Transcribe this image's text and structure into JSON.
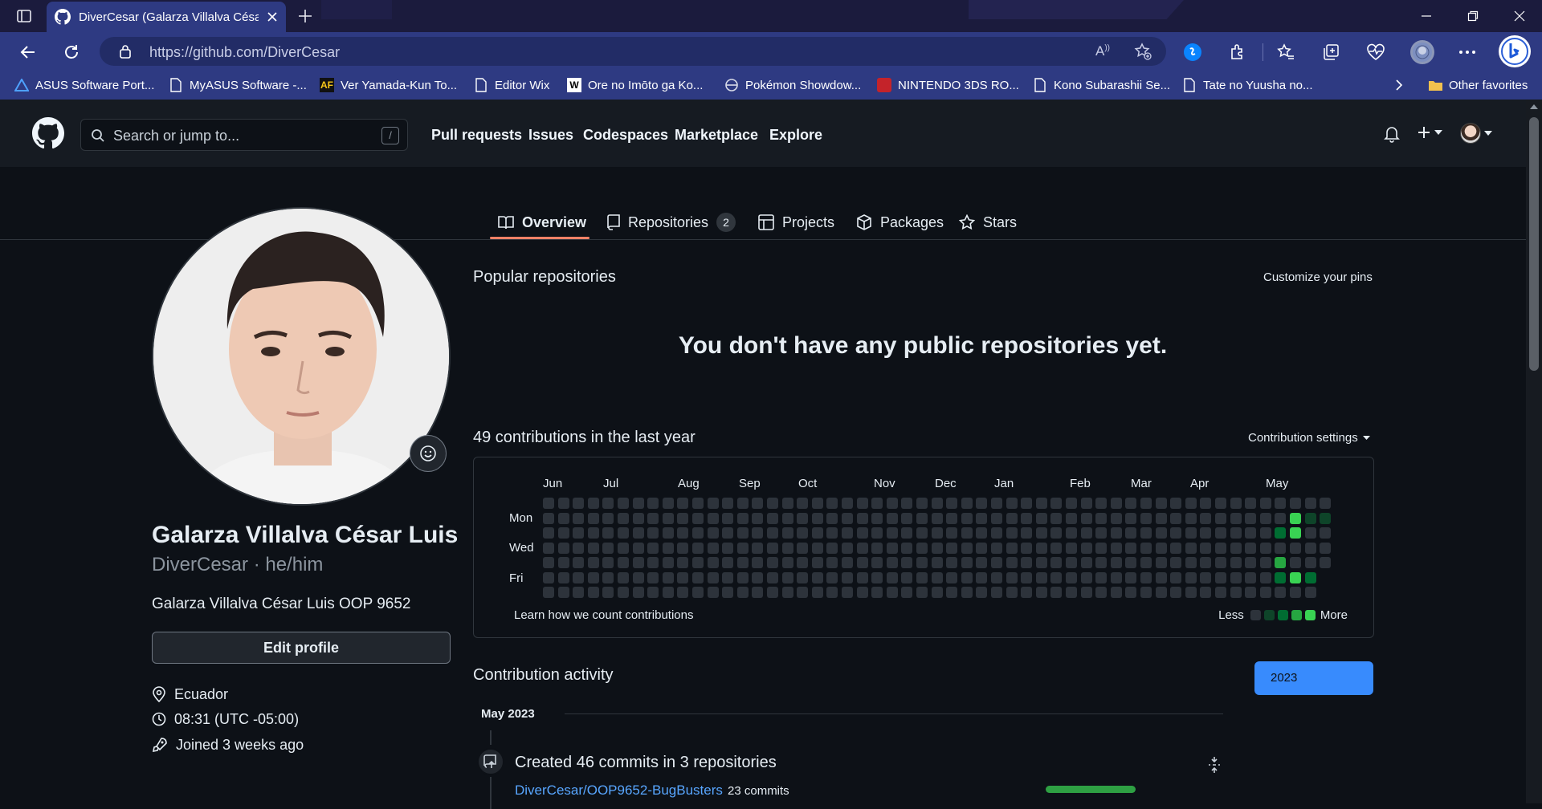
{
  "browser": {
    "tab_title": "DiverCesar (Galarza Villalva Césa",
    "url": "https://github.com/DiverCesar",
    "favorites": [
      {
        "label": "ASUS Software Port...",
        "icon": "asus-icon"
      },
      {
        "label": "MyASUS Software -...",
        "icon": "page-icon"
      },
      {
        "label": "Ver Yamada-Kun To...",
        "icon": "af-icon"
      },
      {
        "label": "Editor Wix",
        "icon": "page-icon"
      },
      {
        "label": "Ore no Imōto ga Ko...",
        "icon": "w-icon"
      },
      {
        "label": "Pokémon Showdow...",
        "icon": "pokeball-icon"
      },
      {
        "label": "NINTENDO 3DS RO...",
        "icon": "nintendo-icon"
      },
      {
        "label": "Kono Subarashii Se...",
        "icon": "page-icon"
      },
      {
        "label": "Tate no Yuusha no...",
        "icon": "page-icon"
      }
    ],
    "other_favorites": "Other favorites",
    "colors": {
      "tabbar": "#1b1b3d",
      "toolbar": "#2e3a82"
    }
  },
  "github": {
    "search_placeholder": "Search or jump to...",
    "search_shortcut": "/",
    "nav": [
      "Pull requests",
      "Issues",
      "Codespaces",
      "Marketplace",
      "Explore"
    ],
    "profile_tabs": [
      {
        "label": "Overview",
        "icon": "book-icon",
        "active": true
      },
      {
        "label": "Repositories",
        "icon": "repo-icon",
        "count": "2"
      },
      {
        "label": "Projects",
        "icon": "table-icon"
      },
      {
        "label": "Packages",
        "icon": "package-icon"
      },
      {
        "label": "Stars",
        "icon": "star-icon"
      }
    ],
    "colors": {
      "bg": "#0d1117",
      "header": "#161b22",
      "accent_tab": "#f78166",
      "link": "#58a6ff",
      "green": "#2ea043"
    }
  },
  "profile": {
    "name": "Galarza Villalva César Luis",
    "login_line": "DiverCesar · he/him",
    "bio": "Galarza Villalva César Luis OOP 9652",
    "edit_button": "Edit profile",
    "location": "Ecuador",
    "time": "08:31 (UTC -05:00)",
    "joined": "Joined 3 weeks ago"
  },
  "main": {
    "popular_title": "Popular repositories",
    "customize_pins": "Customize your pins",
    "empty_message": "You don't have any public repositories yet.",
    "contrib_title": "49 contributions in the last year",
    "contrib_settings": "Contribution settings",
    "graph": {
      "months": [
        "Jun",
        "Jul",
        "Aug",
        "Sep",
        "Oct",
        "Nov",
        "Dec",
        "Jan",
        "Feb",
        "Mar",
        "Apr",
        "May"
      ],
      "days": [
        "Mon",
        "Wed",
        "Fri"
      ],
      "learn_link": "Learn how we count contributions",
      "legend_less": "Less",
      "legend_more": "More",
      "level_colors": [
        "#2d333b",
        "#0e4429",
        "#006d32",
        "#26a641",
        "#39d353"
      ],
      "weeks": 53,
      "last_week_days": 5,
      "active_cells": [
        {
          "week": 49,
          "day": 2,
          "level": 2
        },
        {
          "week": 49,
          "day": 4,
          "level": 3
        },
        {
          "week": 49,
          "day": 5,
          "level": 2
        },
        {
          "week": 50,
          "day": 1,
          "level": 4
        },
        {
          "week": 50,
          "day": 2,
          "level": 4
        },
        {
          "week": 50,
          "day": 5,
          "level": 4
        },
        {
          "week": 51,
          "day": 1,
          "level": 1
        },
        {
          "week": 51,
          "day": 5,
          "level": 2
        },
        {
          "week": 52,
          "day": 1,
          "level": 1
        }
      ]
    },
    "activity_title": "Contribution activity",
    "year": "2023",
    "month_header": "May 2023",
    "commits_summary": "Created 46 commits in 3 repositories",
    "repo_name": "DiverCesar/OOP9652-BugBusters",
    "repo_commits": "23 commits"
  }
}
